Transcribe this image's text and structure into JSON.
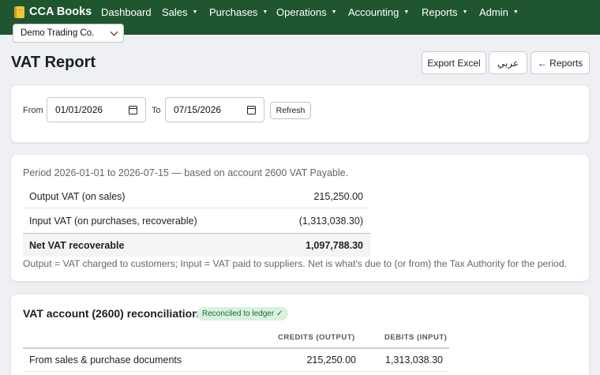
{
  "nav": {
    "brand": "CCA Books",
    "items": [
      "Dashboard",
      "Sales",
      "Purchases",
      "Operations",
      "Accounting",
      "Reports",
      "Admin"
    ],
    "company": "Demo Trading Co."
  },
  "page": {
    "title": "VAT Report",
    "buttons": {
      "export": "Export Excel",
      "arabic": "عربي",
      "reports": "← Reports"
    }
  },
  "filters": {
    "from_label": "From",
    "from_value": "01/01/2026",
    "to_label": "To",
    "to_value": "07/15/2026",
    "refresh": "Refresh"
  },
  "summary": {
    "period": "Period 2026-01-01 to 2026-07-15 — based on account 2600 VAT Payable.",
    "rows": [
      {
        "label": "Output VAT (on sales)",
        "value": "215,250.00"
      },
      {
        "label": "Input VAT (on purchases, recoverable)",
        "value": "(1,313,038.30)"
      },
      {
        "label": "Net VAT recoverable",
        "value": "1,097,788.30"
      }
    ],
    "note": "Output = VAT charged to customers; Input = VAT paid to suppliers. Net is what's due to (or from) the Tax Authority for the period."
  },
  "reconciliation": {
    "title": "VAT account (2600) reconciliation",
    "badge": "Reconciled to ledger ✓",
    "columns": [
      "CREDITS (OUTPUT)",
      "DEBITS (INPUT)"
    ],
    "rows": [
      {
        "label": "From sales & purchase documents",
        "credits": "215,250.00",
        "debits": "1,313,038.30"
      }
    ]
  },
  "colors": {
    "nav_bg": "#1f5630",
    "badge_bg": "#d9f1df",
    "badge_text": "#1d6b34"
  }
}
